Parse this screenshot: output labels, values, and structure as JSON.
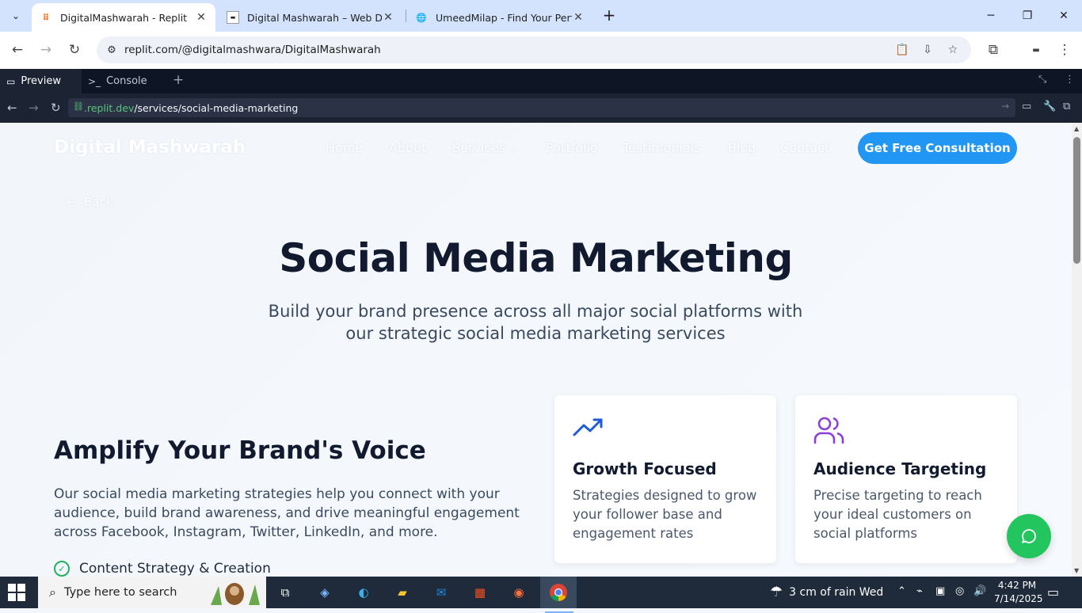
{
  "browser": {
    "tabs": [
      {
        "title": "DigitalMashwarah - Replit",
        "active": true
      },
      {
        "title": "Digital Mashwarah – Web Devel",
        "active": false
      },
      {
        "title": "UmeedMilap - Find Your Perfec",
        "active": false
      }
    ],
    "url": "replit.com/@digitalmashwara/DigitalMashwarah"
  },
  "replit": {
    "tabs": [
      {
        "label": "Preview",
        "active": true
      },
      {
        "label": "Console",
        "active": false
      }
    ],
    "url_host": ".replit.dev",
    "url_path": "/services/social-media-marketing"
  },
  "site": {
    "logo": "Digital Mashwarah",
    "nav": [
      "Home",
      "About",
      "Services",
      "Portfolio",
      "Testimonials",
      "Blog",
      "Contact"
    ],
    "cta": "Get Free Consultation",
    "back": "Back",
    "title": "Social Media Marketing",
    "subtitle": "Build your brand presence across all major social platforms with our strategic social media marketing services",
    "section_title": "Amplify Your Brand's Voice",
    "section_text": "Our social media marketing strategies help you connect with your audience, build brand awareness, and drive meaningful engagement across Facebook, Instagram, Twitter, LinkedIn, and more.",
    "checklist": [
      "Content Strategy & Creation"
    ],
    "cards": [
      {
        "title": "Growth Focused",
        "desc": "Strategies designed to grow your follower base and engagement rates",
        "icon": "trending-up-icon",
        "color": "#1e5bd6"
      },
      {
        "title": "Audience Targeting",
        "desc": "Precise targeting to reach your ideal customers on social platforms",
        "icon": "users-icon",
        "color": "#8b3fd9"
      }
    ],
    "accent": "#2196f3",
    "chat_color": "#22c55e"
  },
  "taskbar": {
    "search_placeholder": "Type here to search",
    "weather": "3 cm of rain Wed",
    "time": "4:42 PM",
    "date": "7/14/2025"
  }
}
